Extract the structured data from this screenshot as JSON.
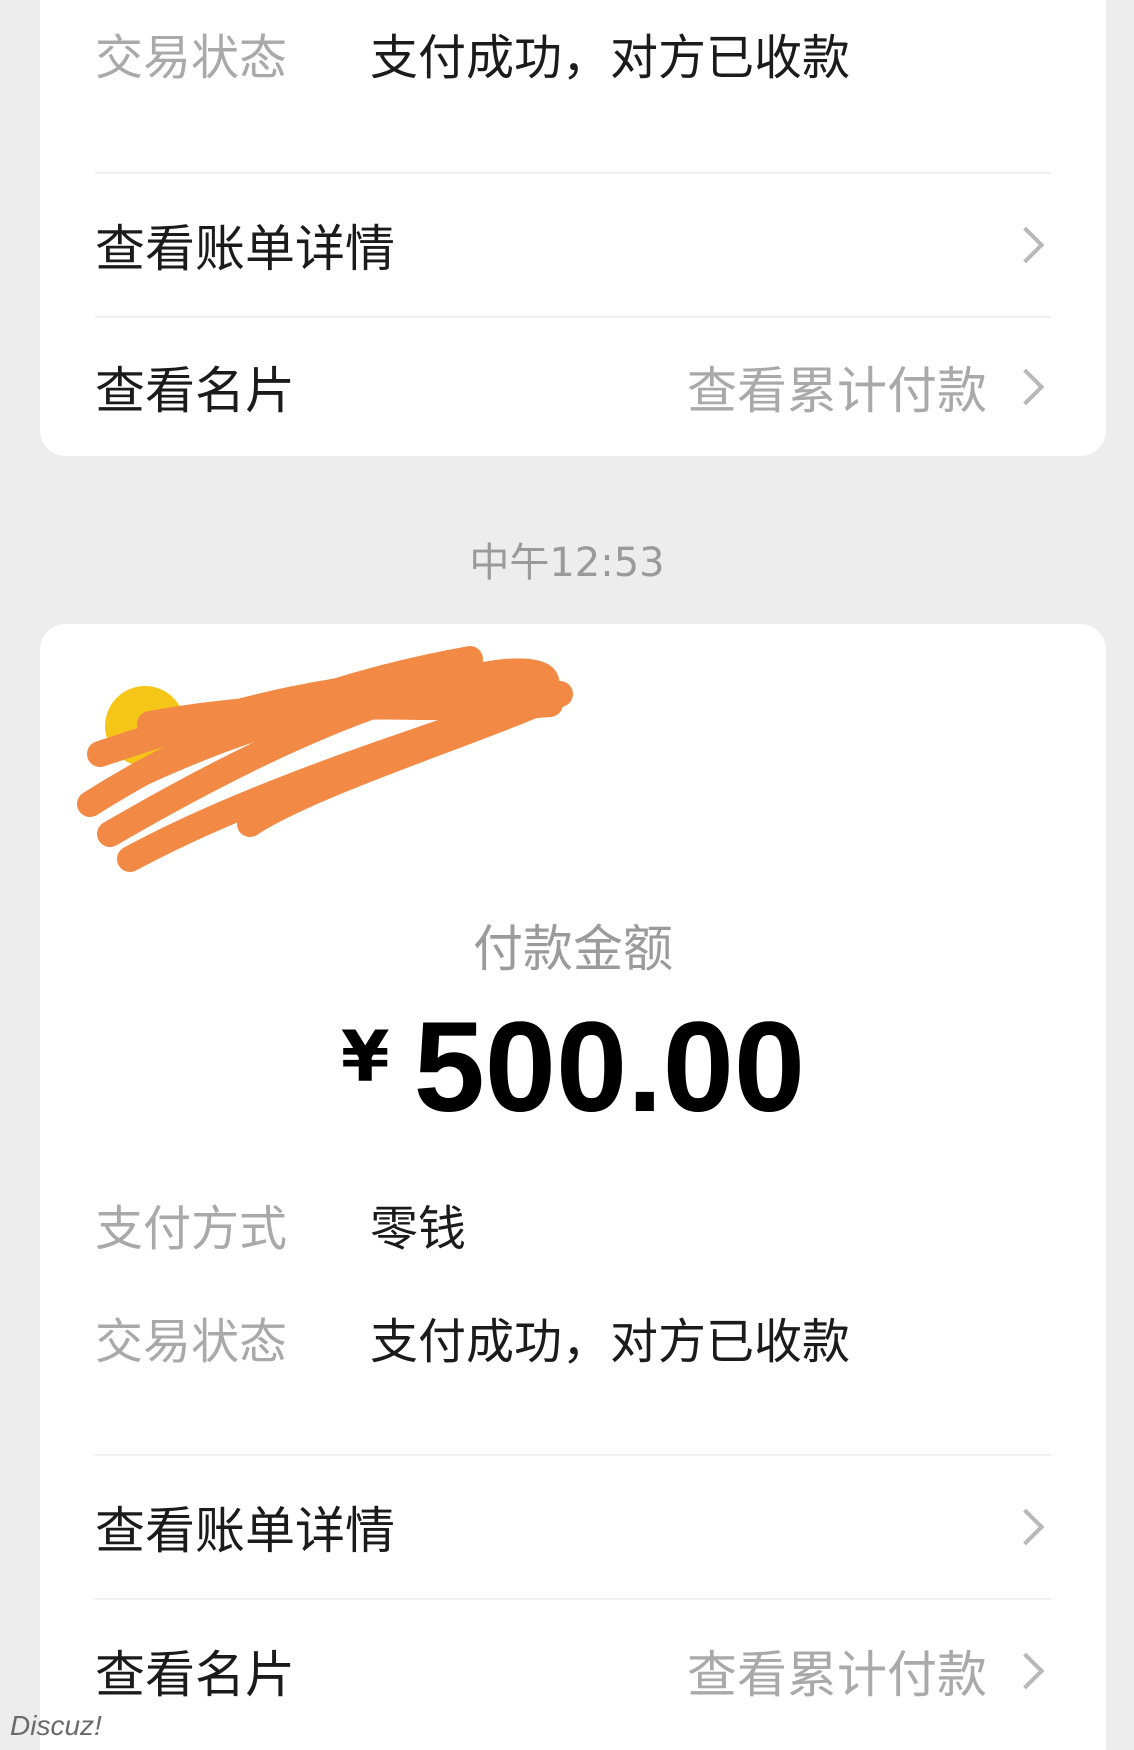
{
  "top_card": {
    "status_label": "交易状态",
    "status_value": "支付成功，对方已收款",
    "bill_link": "查看账单详情",
    "card_link": "查看名片",
    "cumulative_link": "查看累计付款"
  },
  "time_divider": "中午12:53",
  "bottom_card": {
    "amount_label": "付款金额",
    "currency": "¥",
    "amount": "500.00",
    "method_label": "支付方式",
    "method_value": "零钱",
    "status_label": "交易状态",
    "status_value": "支付成功，对方已收款",
    "bill_link": "查看账单详情",
    "card_link": "查看名片",
    "cumulative_link": "查看累计付款"
  },
  "watermark": "Discuz!",
  "colors": {
    "background": "#ededed",
    "card": "#ffffff",
    "redaction": "#f28a46",
    "avatar": "#f5c518"
  }
}
